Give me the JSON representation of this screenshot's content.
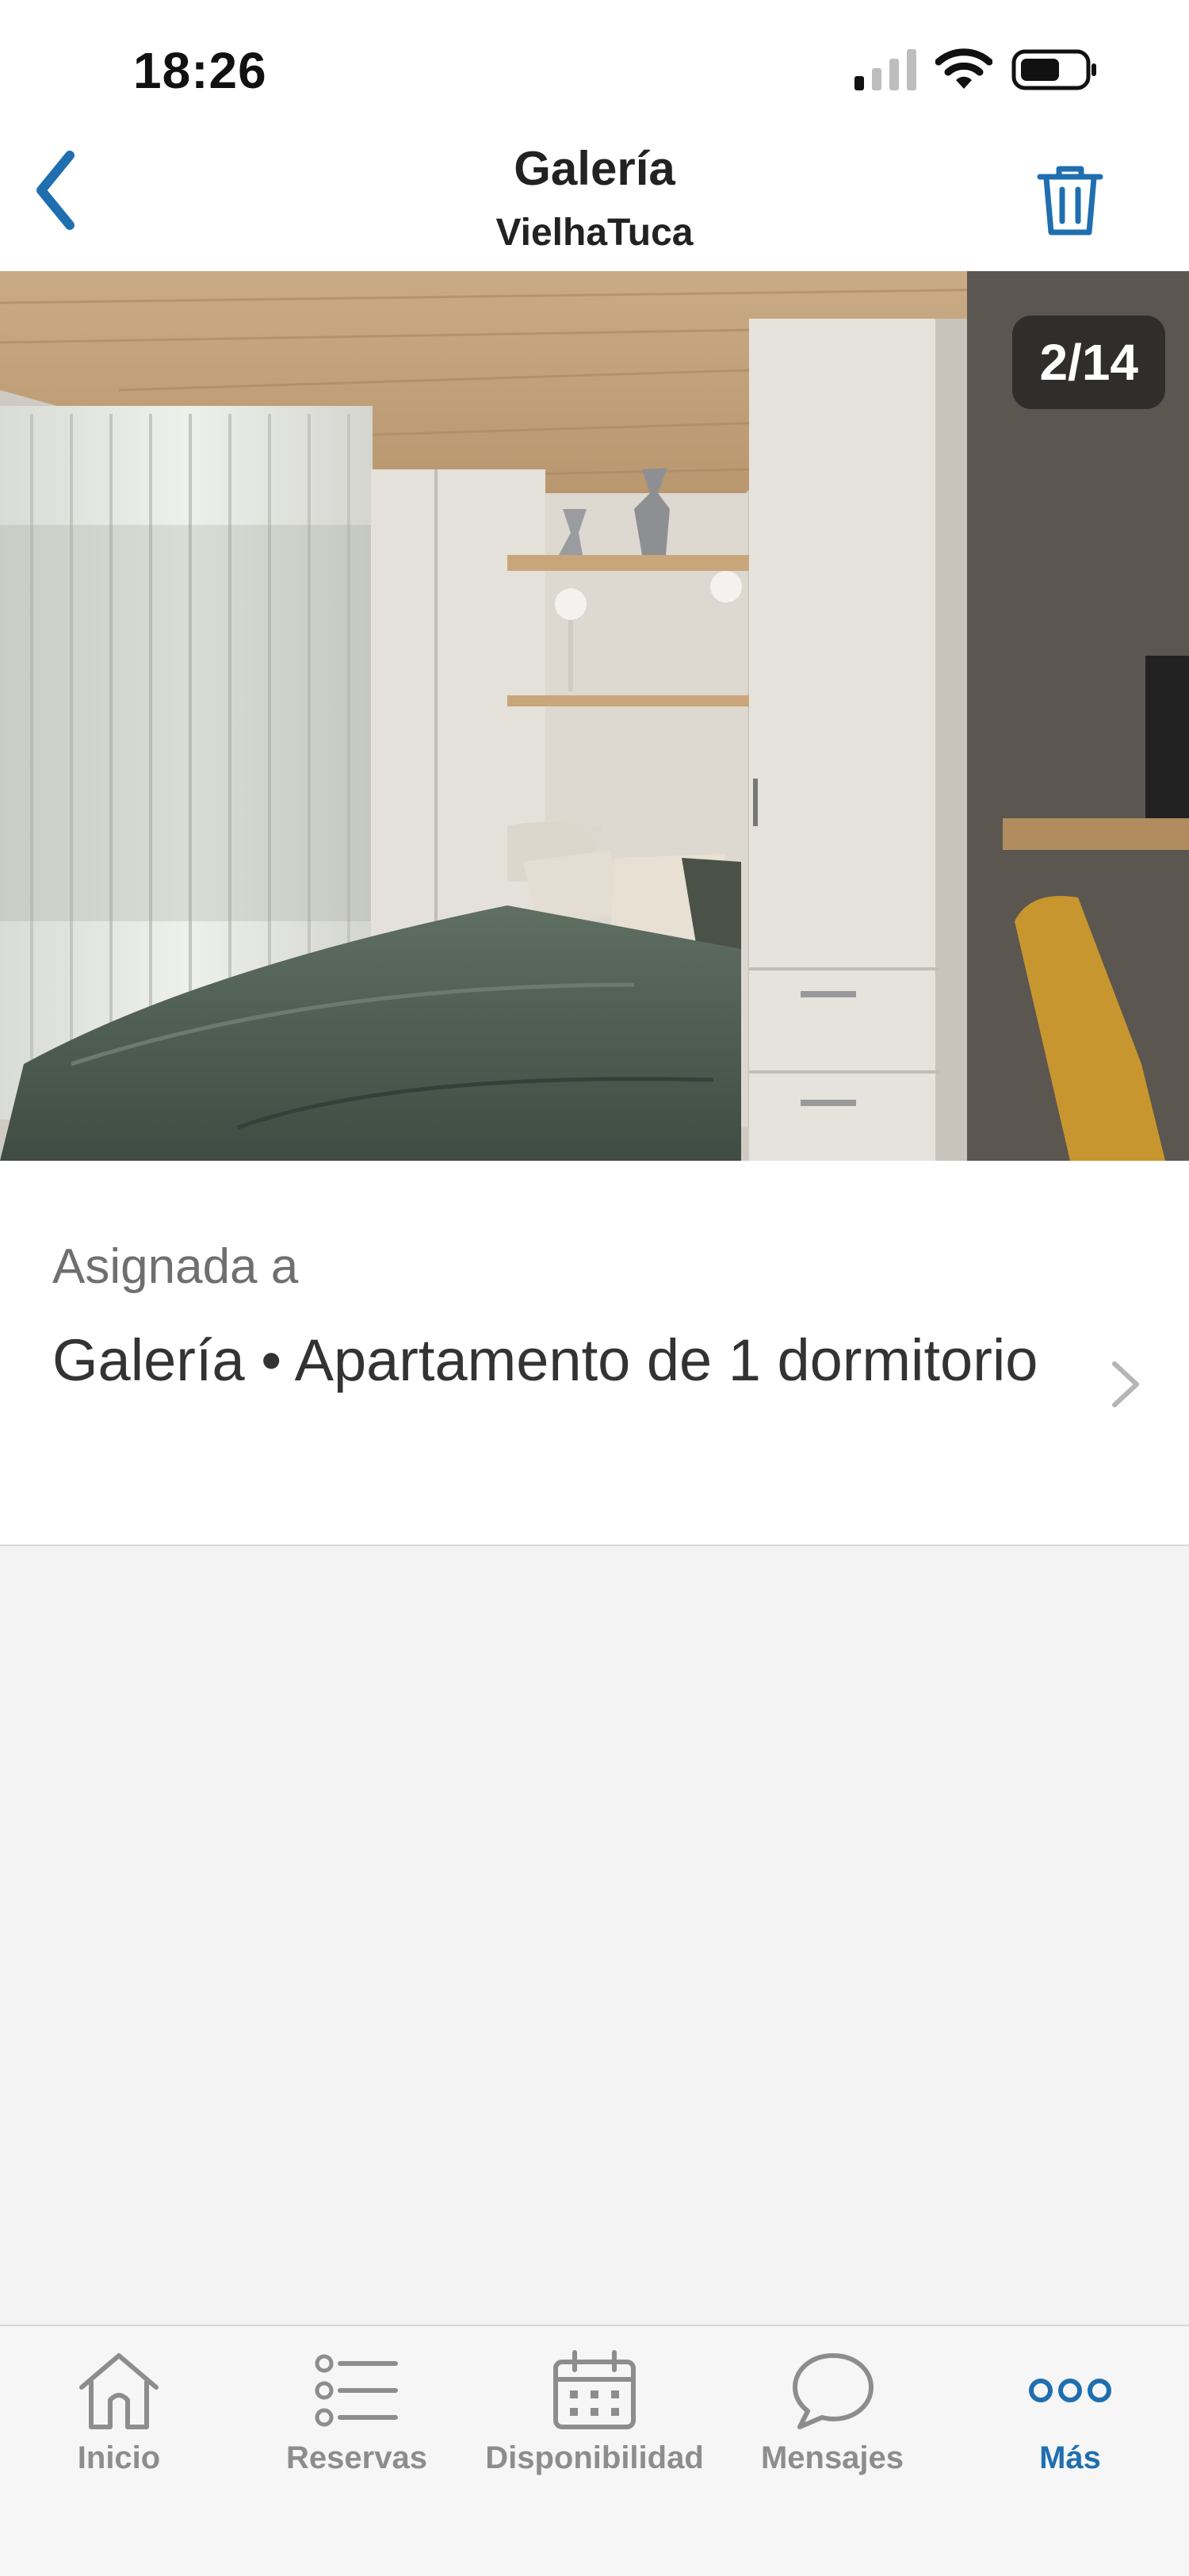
{
  "status_bar": {
    "time": "18:26"
  },
  "header": {
    "title": "Galería",
    "subtitle": "VielhaTuca"
  },
  "photo": {
    "counter": "2/14",
    "current": 2,
    "total": 14
  },
  "assigned": {
    "label": "Asignada a",
    "value": "Galería • Apartamento de 1 dormitorio"
  },
  "tabbar": {
    "tabs": [
      {
        "label": "Inicio",
        "icon": "home-icon"
      },
      {
        "label": "Reservas",
        "icon": "list-icon"
      },
      {
        "label": "Disponibilidad",
        "icon": "calendar-icon"
      },
      {
        "label": "Mensajes",
        "icon": "chat-bubble-icon"
      },
      {
        "label": "Más",
        "icon": "more-dots-icon"
      }
    ],
    "active": "Más"
  },
  "colors": {
    "accent": "#1f6fb0",
    "tab_inactive": "#8d8d8d",
    "background": "#f3f3f3"
  }
}
